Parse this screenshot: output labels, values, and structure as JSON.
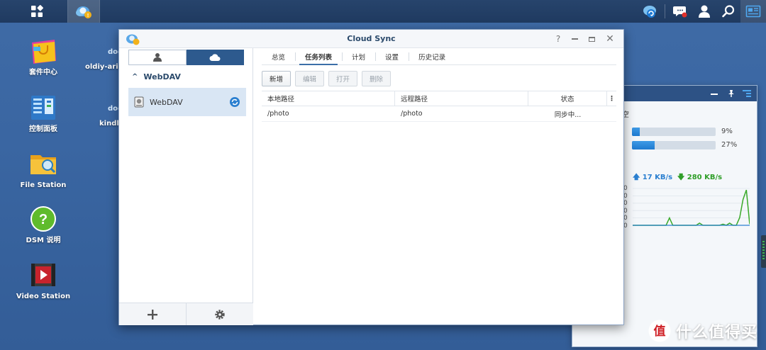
{
  "colors": {
    "desktop": "#3a66a2",
    "taskbar": "#1f3a60",
    "accent": "#2d5a8e",
    "selection": "#d9e6f4",
    "upload": "#2a7fd0",
    "download": "#2f9e28"
  },
  "taskbar": {
    "left_icons": [
      "main-menu-icon",
      "cloud-sync-app-icon"
    ],
    "right_icons": [
      "cloud-sync-status-icon",
      "notification-chat-icon",
      "user-icon",
      "search-icon",
      "widgets-icon"
    ]
  },
  "desktop": {
    "icons": [
      {
        "label": "套件中心",
        "icon": "package-center-icon"
      },
      {
        "label": "控制面板",
        "icon": "control-panel-icon"
      },
      {
        "label": "File Station",
        "icon": "file-station-icon"
      },
      {
        "label": "DSM 说明",
        "icon": "help-icon"
      },
      {
        "label": "Video Station",
        "icon": "video-station-icon"
      }
    ],
    "partial_icons": [
      {
        "label": "oldiy-aria",
        "icon": "docker-icon"
      },
      {
        "label": "kindle",
        "icon": "docker-icon"
      }
    ]
  },
  "widget": {
    "partial_title_char": "空",
    "bars": [
      {
        "label": "9%",
        "value": 0.09
      },
      {
        "label": "27%",
        "value": 0.27
      }
    ],
    "upload_speed": "17 KB/s",
    "download_speed": "280 KB/s",
    "axis_partial_labels": [
      "0",
      "0",
      "0",
      "0",
      "0",
      "0"
    ],
    "series": [
      0,
      0,
      0,
      0,
      0,
      0,
      0,
      0,
      0,
      0,
      0,
      1,
      0,
      0,
      0,
      0,
      0,
      0,
      0,
      0,
      0.3,
      0,
      0,
      0,
      0,
      0,
      0,
      0.15,
      0,
      0.3,
      0,
      0,
      1.05,
      3.5,
      4.8,
      0.15
    ]
  },
  "window": {
    "title": "Cloud Sync",
    "controls": [
      "help-icon",
      "minimize-icon",
      "maximize-icon",
      "close-icon"
    ],
    "left": {
      "seg_icons": [
        "user-icon",
        "cloud-icon"
      ],
      "group": "WebDAV",
      "account": "WebDAV",
      "footer_icons": [
        "add-icon",
        "settings-icon"
      ]
    },
    "tabs": [
      "总览",
      "任务列表",
      "计划",
      "设置",
      "历史记录"
    ],
    "active_tab": 1,
    "toolbar": {
      "new": "新增",
      "edit": "编辑",
      "open": "打开",
      "delete": "删除"
    },
    "table": {
      "headers": {
        "local": "本地路径",
        "remote": "远程路径",
        "status": "状态"
      },
      "rows": [
        {
          "local": "/photo",
          "remote": "/photo",
          "status": "同步中..."
        }
      ]
    }
  },
  "watermark": {
    "text": "什么值得买",
    "badge": "值"
  }
}
